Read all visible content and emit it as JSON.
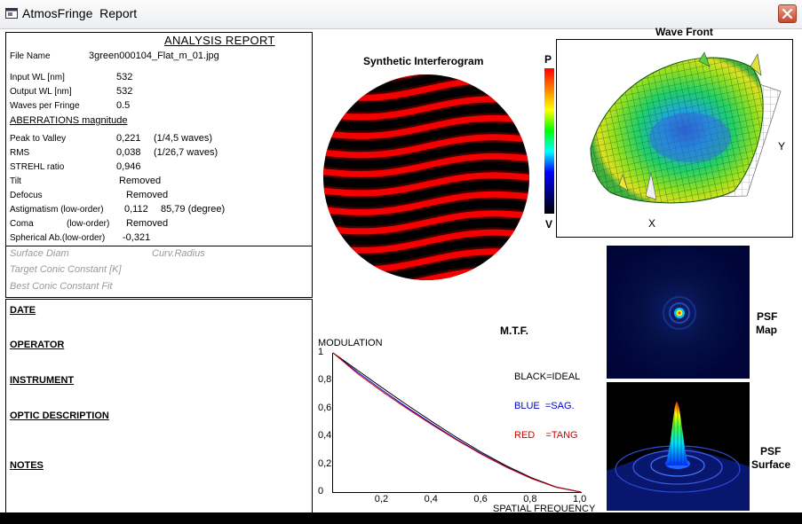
{
  "window": {
    "title": "AtmosFringe  Report",
    "app_icon": "report-window-icon",
    "close_icon": "close-icon"
  },
  "report": {
    "title": "ANALYSIS  REPORT",
    "file_name_label": "File Name",
    "file_name_value": "3green000104_Flat_m_01.jpg",
    "input_wl_label": "Input  WL [nm]",
    "input_wl_value": "532",
    "output_wl_label": "Output WL [nm]",
    "output_wl_value": "532",
    "waves_label": "Waves per Fringe",
    "waves_value": "0.5",
    "aberrations_title": "ABERRATIONS magnitude",
    "ptv_label": "Peak to Valley",
    "ptv_value": "0,221",
    "ptv_waves": "(1/4,5 waves)",
    "rms_label": "RMS",
    "rms_value": "0,038",
    "rms_waves": "(1/26,7 waves)",
    "strehl_label": "STREHL ratio",
    "strehl_value": "0,946",
    "tilt_label": "Tilt",
    "tilt_value": "Removed",
    "defocus_label": "Defocus",
    "defocus_value": "Removed",
    "astig_label": "Astigmatism  (low-order)",
    "astig_value": "0,112",
    "astig_angle": "85,79  (degree)",
    "coma_label": "Coma",
    "coma_sub": "(low-order)",
    "coma_value": "Removed",
    "spherical_label": "Spherical Ab.(low-order)",
    "spherical_value": "-0,321"
  },
  "conic": {
    "surface_diam": "Surface Diam",
    "curv_radius": "Curv.Radius",
    "target_conic": "Target Conic Constant [K]",
    "best_conic": "Best Conic Constant Fit"
  },
  "info": {
    "date": "DATE",
    "operator": "OPERATOR",
    "instrument": "INSTRUMENT",
    "optic_description": "OPTIC DESCRIPTION",
    "notes": "NOTES"
  },
  "interferogram": {
    "title": "Synthetic Interferogram",
    "fringe_color": "#ff0000"
  },
  "scale": {
    "top": "P",
    "bottom": "V"
  },
  "wavefront": {
    "title": "Wave Front",
    "axis_x": "X",
    "axis_y": "Y"
  },
  "psf": {
    "map_label_1": "PSF",
    "map_label_2": "Map",
    "surface_label_1": "PSF",
    "surface_label_2": "Surface"
  },
  "chart_data": {
    "type": "line",
    "title": "M.T.F.",
    "ylabel": "MODULATION",
    "xlabel": "SPATIAL FREQUENCY",
    "xlim": [
      0,
      1
    ],
    "ylim": [
      0,
      1
    ],
    "x_ticks": [
      "0,2",
      "0,4",
      "0,6",
      "0,8",
      "1,0"
    ],
    "y_ticks": [
      "0",
      "0,2",
      "0,4",
      "0,6",
      "0,8",
      "1"
    ],
    "legend": [
      "BLACK=IDEAL",
      "BLUE  =SAG.",
      "RED    =TANG"
    ],
    "legend_colors": [
      "#000000",
      "#0000cc",
      "#cc0000"
    ],
    "x": [
      0,
      0.1,
      0.2,
      0.3,
      0.4,
      0.5,
      0.6,
      0.7,
      0.8,
      0.9,
      1.0
    ],
    "series": [
      {
        "name": "IDEAL",
        "color": "#000000",
        "values": [
          1.0,
          0.873,
          0.747,
          0.624,
          0.505,
          0.391,
          0.285,
          0.188,
          0.104,
          0.037,
          0.0
        ]
      },
      {
        "name": "SAG",
        "color": "#0000cc",
        "values": [
          1.0,
          0.86,
          0.73,
          0.607,
          0.49,
          0.378,
          0.275,
          0.18,
          0.099,
          0.035,
          0.0
        ]
      },
      {
        "name": "TANG",
        "color": "#cc0000",
        "values": [
          1.0,
          0.85,
          0.72,
          0.598,
          0.483,
          0.373,
          0.271,
          0.178,
          0.098,
          0.035,
          0.0
        ]
      }
    ]
  }
}
